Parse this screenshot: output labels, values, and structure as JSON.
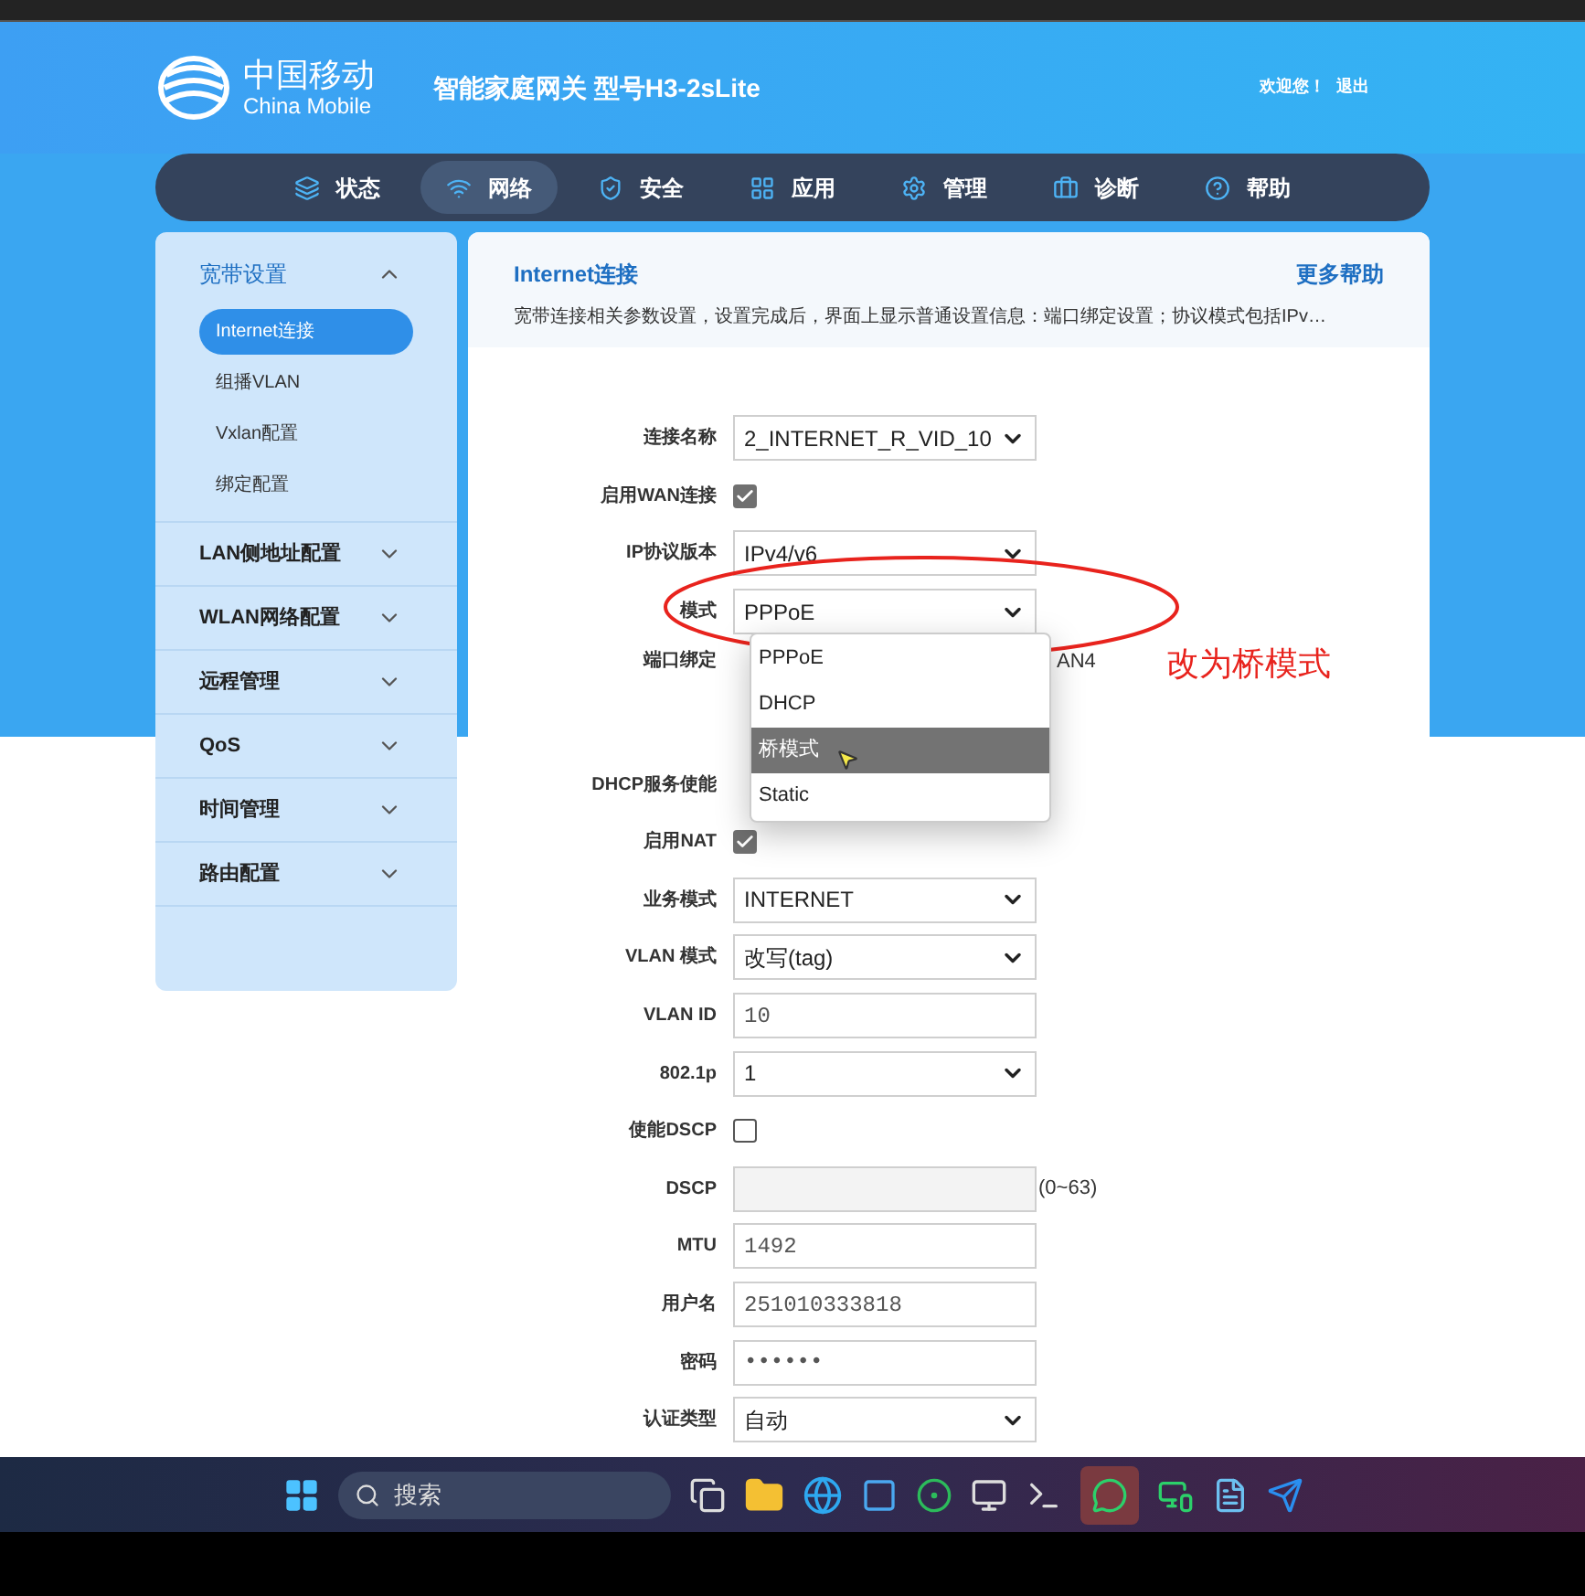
{
  "header": {
    "logo_cn": "中国移动",
    "logo_en": "China Mobile",
    "title": "智能家庭网关 型号H3-2sLite",
    "welcome": "欢迎您！",
    "logout": "退出"
  },
  "nav": [
    {
      "label": "状态",
      "selected": false
    },
    {
      "label": "网络",
      "selected": true
    },
    {
      "label": "安全",
      "selected": false
    },
    {
      "label": "应用",
      "selected": false
    },
    {
      "label": "管理",
      "selected": false
    },
    {
      "label": "诊断",
      "selected": false
    },
    {
      "label": "帮助",
      "selected": false
    }
  ],
  "sidebar": [
    {
      "label": "宽带设置",
      "expanded": true,
      "children": [
        {
          "label": "Internet连接",
          "selected": true
        },
        {
          "label": "组播VLAN",
          "selected": false
        },
        {
          "label": "Vxlan配置",
          "selected": false
        },
        {
          "label": "绑定配置",
          "selected": false
        }
      ]
    },
    {
      "label": "LAN侧地址配置",
      "expanded": false
    },
    {
      "label": "WLAN网络配置",
      "expanded": false
    },
    {
      "label": "远程管理",
      "expanded": false
    },
    {
      "label": "QoS",
      "expanded": false
    },
    {
      "label": "时间管理",
      "expanded": false
    },
    {
      "label": "路由配置",
      "expanded": false
    }
  ],
  "panel": {
    "title": "Internet连接",
    "help": "更多帮助",
    "description": "宽带连接相关参数设置，设置完成后，界面上显示普通设置信息：端口绑定设置；协议模式包括IPv…"
  },
  "form": [
    {
      "kind": "select",
      "label": "连接名称",
      "value": "2_INTERNET_R_VID_10"
    },
    {
      "kind": "checkbox",
      "label": "启用WAN连接",
      "checked": true
    },
    {
      "kind": "select",
      "label": "IP协议版本",
      "value": "IPv4/v6"
    },
    {
      "kind": "select",
      "label": "模式",
      "value": "PPPoE"
    },
    {
      "kind": "ports",
      "label": "端口绑定",
      "value": "AN4"
    },
    {
      "kind": "hidden",
      "label": "DHCP服务使能"
    },
    {
      "kind": "checkbox",
      "label": "启用NAT",
      "checked": true
    },
    {
      "kind": "select",
      "label": "业务模式",
      "value": "INTERNET"
    },
    {
      "kind": "select",
      "label": "VLAN 模式",
      "value": "改写(tag)"
    },
    {
      "kind": "input",
      "label": "VLAN ID",
      "value": "10",
      "disabled": false
    },
    {
      "kind": "select",
      "label": "802.1p",
      "value": "1"
    },
    {
      "kind": "checkbox",
      "label": "使能DSCP",
      "checked": false
    },
    {
      "kind": "input",
      "label": "DSCP",
      "disabled": true,
      "note": "(0~63)"
    },
    {
      "kind": "input",
      "label": "MTU",
      "value": "1492",
      "disabled": false
    },
    {
      "kind": "input",
      "label": "用户名",
      "value": "251010333818",
      "disabled": false
    },
    {
      "kind": "input",
      "label": "密码",
      "value": "••••••",
      "disabled": false
    },
    {
      "kind": "select",
      "label": "认证类型",
      "value": "自动"
    }
  ],
  "dropdown": {
    "options": [
      {
        "label": "PPPoE",
        "selected": false
      },
      {
        "label": "DHCP",
        "selected": false
      },
      {
        "label": "桥模式",
        "selected": true
      },
      {
        "label": "Static",
        "selected": false
      }
    ]
  },
  "annotation": "改为桥模式",
  "taskbar": {
    "search_placeholder": "搜索"
  }
}
